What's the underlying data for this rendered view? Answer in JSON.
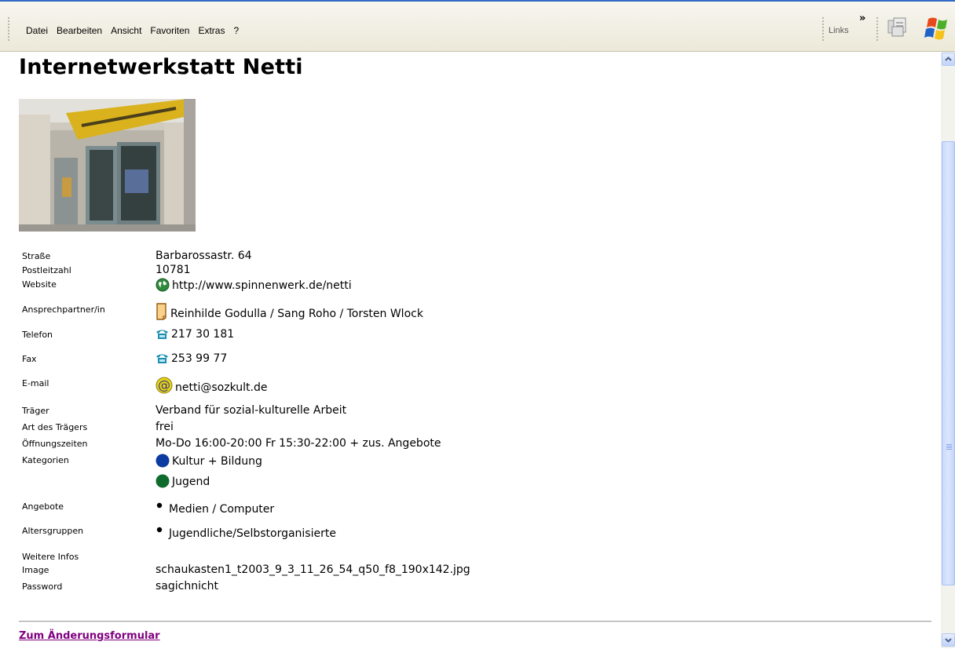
{
  "menu": {
    "items": [
      "Datei",
      "Bearbeiten",
      "Ansicht",
      "Favoriten",
      "Extras",
      "?"
    ],
    "links_label": "Links",
    "chevron": "»"
  },
  "page": {
    "title": "Internetwerkstatt Netti",
    "photo_icon": "storefront-photo",
    "fields": [
      {
        "label": "Straße",
        "value": "Barbarossastr. 64",
        "icon": ""
      },
      {
        "label": "Postleitzahl",
        "value": "10781",
        "icon": ""
      },
      {
        "label": "Website",
        "value": "http://www.spinnenwerk.de/netti",
        "icon": "globe-icon"
      },
      {
        "label": "Ansprechpartner/in",
        "value": "Reinhilde Godulla / Sang Roho / Torsten Wlock",
        "icon": "contact-card-icon"
      },
      {
        "label": "Telefon",
        "value": "217 30 181",
        "icon": "phone-icon"
      },
      {
        "label": "Fax",
        "value": "253 99 77",
        "icon": "phone-icon"
      },
      {
        "label": "E-mail",
        "value": "netti@sozkult.de",
        "icon": "at-icon"
      },
      {
        "label": "Träger",
        "value": "Verband für sozial-kulturelle Arbeit",
        "icon": ""
      },
      {
        "label": "Art des Trägers",
        "value": "frei",
        "icon": ""
      },
      {
        "label": "Öffnungszeiten",
        "value": "Mo-Do 16:00-20:00 Fr 15:30-22:00 + zus. Angebote",
        "icon": ""
      }
    ],
    "kategorien_label": "Kategorien",
    "kategorien": [
      {
        "value": "Kultur + Bildung",
        "color": "#0b3ba0"
      },
      {
        "value": "Jugend",
        "color": "#0f6a2d"
      }
    ],
    "angebote_label": "Angebote",
    "angebote_value": "Medien / Computer",
    "altersgruppen_label": "Altersgruppen",
    "altersgruppen_value": "Jugendliche/Selbstorganisierte",
    "weitere_label": "Weitere Infos",
    "image_label": "Image",
    "image_value": "schaukasten1_t2003_9_3_11_26_54_q50_f8_190x142.jpg",
    "password_label": "Password",
    "password_value": "sagichnicht",
    "change_link": "Zum Änderungsformular"
  },
  "colors": {
    "link_visited": "#800080",
    "phone_icon": "#1a8fb0",
    "at_icon_bg": "#e5d21a"
  }
}
